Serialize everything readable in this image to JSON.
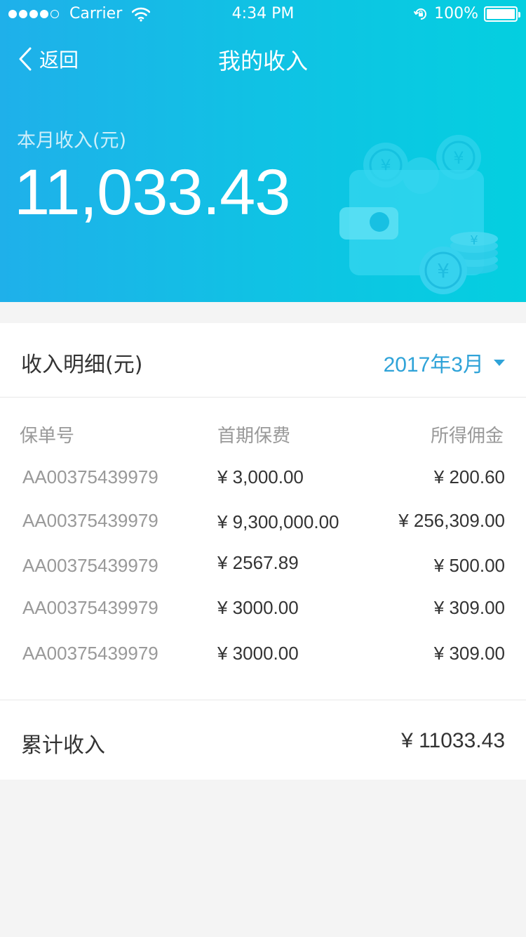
{
  "status_bar": {
    "carrier": "Carrier",
    "time": "4:34 PM",
    "battery": "100%"
  },
  "nav": {
    "back_label": "返回",
    "title": "我的收入"
  },
  "summary": {
    "label": "本月收入(元)",
    "amount": "11,033.43"
  },
  "detail": {
    "title": "收入明细(元)",
    "month": "2017年3月",
    "columns": [
      "保单号",
      "首期保费",
      "所得佣金"
    ],
    "rows": [
      {
        "policy": "AA00375439979",
        "premium": "¥ 3,000.00",
        "commission": "¥ 200.60"
      },
      {
        "policy": "AA00375439979",
        "premium": "¥ 9,300,000.00",
        "commission": "¥ 256,309.00"
      },
      {
        "policy": "AA00375439979",
        "premium": "¥ 2567.89",
        "commission": "¥ 500.00"
      },
      {
        "policy": "AA00375439979",
        "premium": "¥ 3000.00",
        "commission": "¥ 309.00"
      },
      {
        "policy": "AA00375439979",
        "premium": "¥ 3000.00",
        "commission": "¥ 309.00"
      }
    ],
    "total_label": "累计收入",
    "total_value": "¥ 11033.43"
  },
  "colors": {
    "accent": "#2fa3d8",
    "header_start": "#1fb0ea",
    "header_end": "#04cfe0"
  }
}
